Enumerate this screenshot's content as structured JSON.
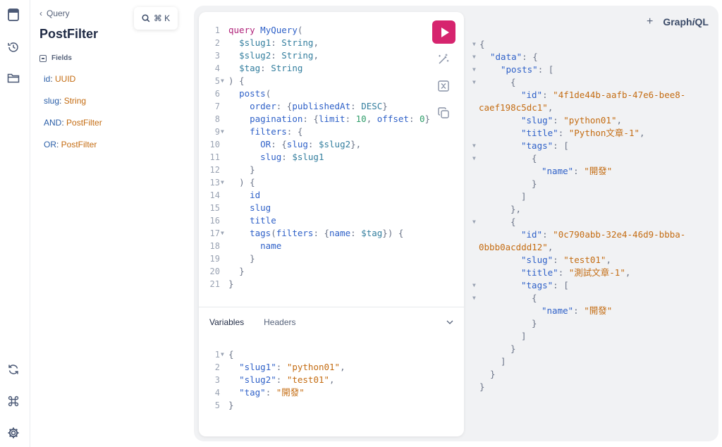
{
  "rail": {
    "icons": [
      "docs-icon",
      "history-icon",
      "folder-icon",
      "refetch-icon",
      "shortcut-icon",
      "settings-icon"
    ]
  },
  "docs": {
    "back_label": "Query",
    "title": "PostFilter",
    "fields_heading": "Fields",
    "fields": [
      {
        "name": "id",
        "type": "UUID"
      },
      {
        "name": "slug",
        "type": "String"
      },
      {
        "name": "AND",
        "type": "PostFilter"
      },
      {
        "name": "OR",
        "type": "PostFilter"
      }
    ]
  },
  "search": {
    "shortcut": "⌘ K"
  },
  "brand": {
    "add": "+",
    "name_a": "Graph",
    "name_b": "i",
    "name_c": "QL"
  },
  "editor": {
    "tabs": [
      "Variables",
      "Headers"
    ]
  },
  "colors": {
    "run_button": "#d6246e",
    "panel_bg": "#f1f2f4"
  }
}
